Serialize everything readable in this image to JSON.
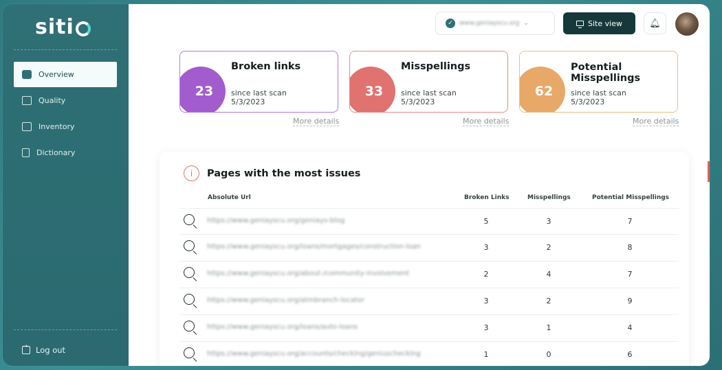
{
  "sidebar": {
    "logo_text": "siti",
    "items": [
      {
        "label": "Overview",
        "icon": "overview-icon",
        "active": true
      },
      {
        "label": "Quality",
        "icon": "quality-icon",
        "active": false
      },
      {
        "label": "Inventory",
        "icon": "inventory-icon",
        "active": false
      },
      {
        "label": "Dictionary",
        "icon": "dictionary-icon",
        "active": false
      }
    ],
    "logout_label": "Log out"
  },
  "header": {
    "domain": "www.geniayscu.org",
    "site_view_label": "Site view",
    "bell_icon": "bell-icon"
  },
  "cards": [
    {
      "title": "Broken links",
      "count": "23",
      "sub1": "since last scan",
      "sub2": "5/3/2023",
      "color": "#a35ccd",
      "border": "#b07ad4",
      "more": "More details"
    },
    {
      "title": "Misspellings",
      "count": "33",
      "sub1": "since last scan",
      "sub2": "5/3/2023",
      "color": "#e0736f",
      "border": "#e48a86",
      "more": "More details"
    },
    {
      "title": "Potential Misspellings",
      "count": "62",
      "sub1": "since last scan",
      "sub2": "5/3/2023",
      "color": "#e8a868",
      "border": "#edbb88",
      "more": "More details"
    }
  ],
  "issues": {
    "title": "Pages with the most issues",
    "columns": [
      "Absolute Url",
      "Broken Links",
      "Misspellings",
      "Potential Misspellings"
    ],
    "rows": [
      {
        "url": "https://www.geniayscu.org/geniays-blog",
        "broken": "5",
        "misspellings": "3",
        "potential": "7"
      },
      {
        "url": "https://www.geniayscu.org/loans/mortgages/construction-loan",
        "broken": "3",
        "misspellings": "2",
        "potential": "8"
      },
      {
        "url": "https://www.geniayscu.org/about-/community-involvement",
        "broken": "2",
        "misspellings": "4",
        "potential": "7"
      },
      {
        "url": "https://www.geniayscu.org/atmbranch-locator",
        "broken": "3",
        "misspellings": "2",
        "potential": "9"
      },
      {
        "url": "https://www.geniayscu.org/loans/auto-loans",
        "broken": "3",
        "misspellings": "1",
        "potential": "4"
      },
      {
        "url": "https://www.geniayscu.org/accounts/checking/geniuschecking",
        "broken": "1",
        "misspellings": "0",
        "potential": "6"
      }
    ]
  }
}
